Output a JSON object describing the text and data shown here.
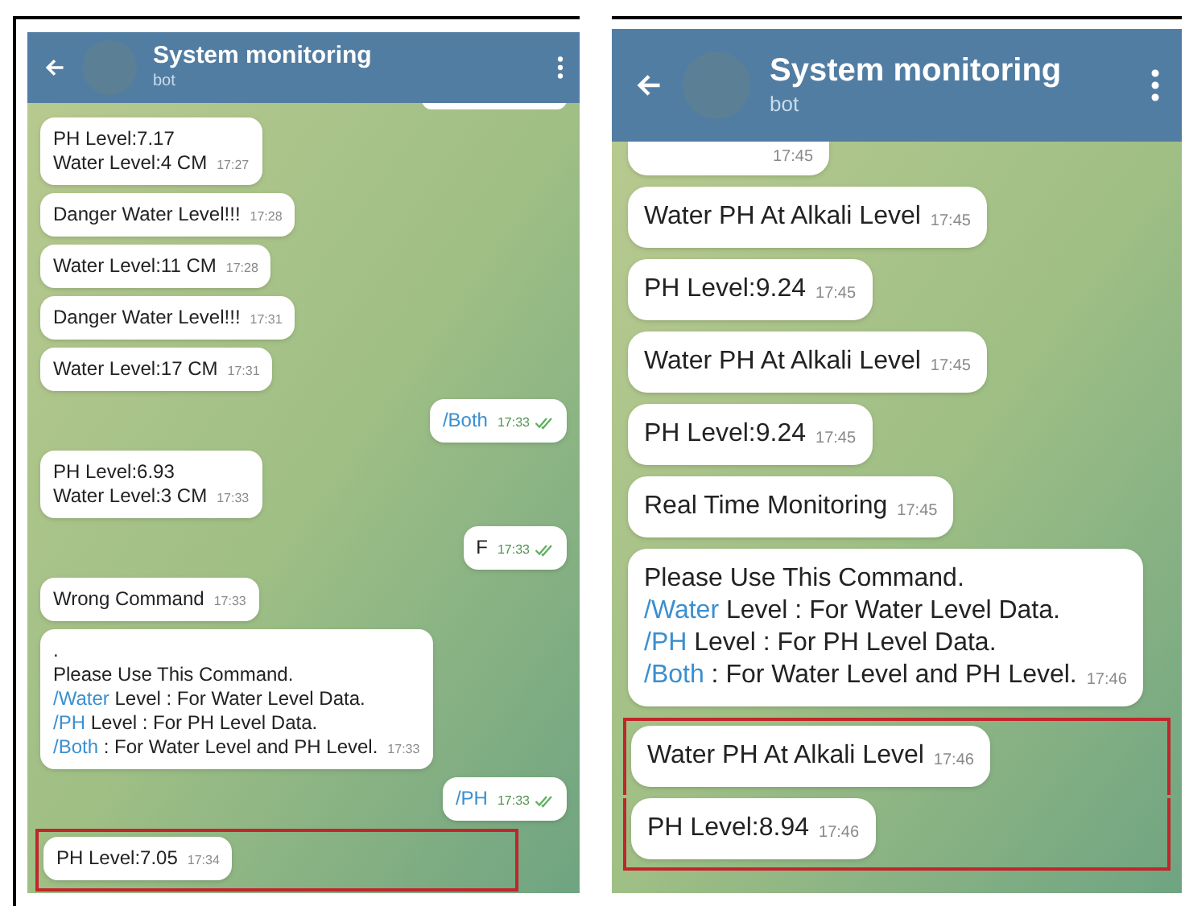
{
  "phones": [
    {
      "title": "System monitoring",
      "subtitle": "bot",
      "top_bubble_cut": true,
      "messages": [
        {
          "kind": "incoming",
          "lines": [
            [
              {
                "kind": "plain",
                "text": "PH Level:7.17"
              }
            ],
            [
              {
                "kind": "plain",
                "text": "Water Level:4 CM"
              }
            ]
          ],
          "time": "17:27",
          "highlighted": false
        },
        {
          "kind": "incoming",
          "lines": [
            [
              {
                "kind": "plain",
                "text": "Danger Water Level!!!"
              }
            ]
          ],
          "time": "17:28",
          "highlighted": false
        },
        {
          "kind": "incoming",
          "lines": [
            [
              {
                "kind": "plain",
                "text": "Water Level:11 CM"
              }
            ]
          ],
          "time": "17:28",
          "highlighted": false
        },
        {
          "kind": "incoming",
          "lines": [
            [
              {
                "kind": "plain",
                "text": "Danger Water Level!!!"
              }
            ]
          ],
          "time": "17:31",
          "highlighted": false
        },
        {
          "kind": "incoming",
          "lines": [
            [
              {
                "kind": "plain",
                "text": "Water Level:17 CM"
              }
            ]
          ],
          "time": "17:31",
          "highlighted": false
        },
        {
          "kind": "outgoing",
          "lines": [
            [
              {
                "kind": "command",
                "text": "/Both"
              }
            ]
          ],
          "time": "17:33",
          "read": true,
          "highlighted": false
        },
        {
          "kind": "incoming",
          "lines": [
            [
              {
                "kind": "plain",
                "text": "PH Level:6.93"
              }
            ],
            [
              {
                "kind": "plain",
                "text": "Water Level:3 CM"
              }
            ]
          ],
          "time": "17:33",
          "highlighted": false
        },
        {
          "kind": "outgoing",
          "lines": [
            [
              {
                "kind": "plain",
                "text": "F"
              }
            ]
          ],
          "time": "17:33",
          "read": true,
          "highlighted": false
        },
        {
          "kind": "incoming",
          "lines": [
            [
              {
                "kind": "plain",
                "text": "Wrong Command"
              }
            ]
          ],
          "time": "17:33",
          "highlighted": false
        },
        {
          "kind": "incoming",
          "lines": [
            [
              {
                "kind": "plain",
                "text": "."
              }
            ],
            [
              {
                "kind": "plain",
                "text": "Please Use This Command."
              }
            ],
            [
              {
                "kind": "command",
                "text": "/Water"
              },
              {
                "kind": "plain",
                "text": " Level : For Water Level Data."
              }
            ],
            [
              {
                "kind": "command",
                "text": "/PH"
              },
              {
                "kind": "plain",
                "text": " Level : For PH Level Data."
              }
            ],
            [
              {
                "kind": "command",
                "text": "/Both"
              },
              {
                "kind": "plain",
                "text": " : For Water Level and PH Level."
              }
            ]
          ],
          "time": "17:33",
          "highlighted": false
        },
        {
          "kind": "outgoing",
          "lines": [
            [
              {
                "kind": "command",
                "text": "/PH"
              }
            ]
          ],
          "time": "17:33",
          "read": true,
          "highlighted": false
        },
        {
          "kind": "incoming",
          "lines": [
            [
              {
                "kind": "plain",
                "text": "PH Level:7.05"
              }
            ]
          ],
          "time": "17:34",
          "highlighted": true
        }
      ]
    },
    {
      "title": "System monitoring",
      "subtitle": "bot",
      "messages": [
        {
          "kind": "incoming",
          "time": "17:45",
          "highlighted": false,
          "cut": true
        },
        {
          "kind": "incoming",
          "lines": [
            [
              {
                "kind": "plain",
                "text": "Water PH At Alkali Level"
              }
            ]
          ],
          "time": "17:45",
          "highlighted": false
        },
        {
          "kind": "incoming",
          "lines": [
            [
              {
                "kind": "plain",
                "text": "PH Level:9.24"
              }
            ]
          ],
          "time": "17:45",
          "highlighted": false
        },
        {
          "kind": "incoming",
          "lines": [
            [
              {
                "kind": "plain",
                "text": "Water PH At Alkali Level"
              }
            ]
          ],
          "time": "17:45",
          "highlighted": false
        },
        {
          "kind": "incoming",
          "lines": [
            [
              {
                "kind": "plain",
                "text": "PH Level:9.24"
              }
            ]
          ],
          "time": "17:45",
          "highlighted": false
        },
        {
          "kind": "incoming",
          "lines": [
            [
              {
                "kind": "plain",
                "text": "Real Time Monitoring"
              }
            ]
          ],
          "time": "17:45",
          "highlighted": false
        },
        {
          "kind": "incoming",
          "lines": [
            [
              {
                "kind": "plain",
                "text": "Please Use This Command."
              }
            ],
            [
              {
                "kind": "command",
                "text": "/Water"
              },
              {
                "kind": "plain",
                "text": " Level : For Water Level Data."
              }
            ],
            [
              {
                "kind": "command",
                "text": "/PH"
              },
              {
                "kind": "plain",
                "text": " Level : For PH Level Data."
              }
            ],
            [
              {
                "kind": "command",
                "text": "/Both"
              },
              {
                "kind": "plain",
                "text": " : For Water Level and PH Level."
              }
            ]
          ],
          "time": "17:46",
          "highlighted": false
        },
        {
          "kind": "incoming",
          "lines": [
            [
              {
                "kind": "plain",
                "text": "Water PH At Alkali Level"
              }
            ]
          ],
          "time": "17:46",
          "highlighted": true
        },
        {
          "kind": "incoming",
          "lines": [
            [
              {
                "kind": "plain",
                "text": "PH Level:8.94"
              }
            ]
          ],
          "time": "17:46",
          "highlighted": true
        }
      ]
    }
  ]
}
